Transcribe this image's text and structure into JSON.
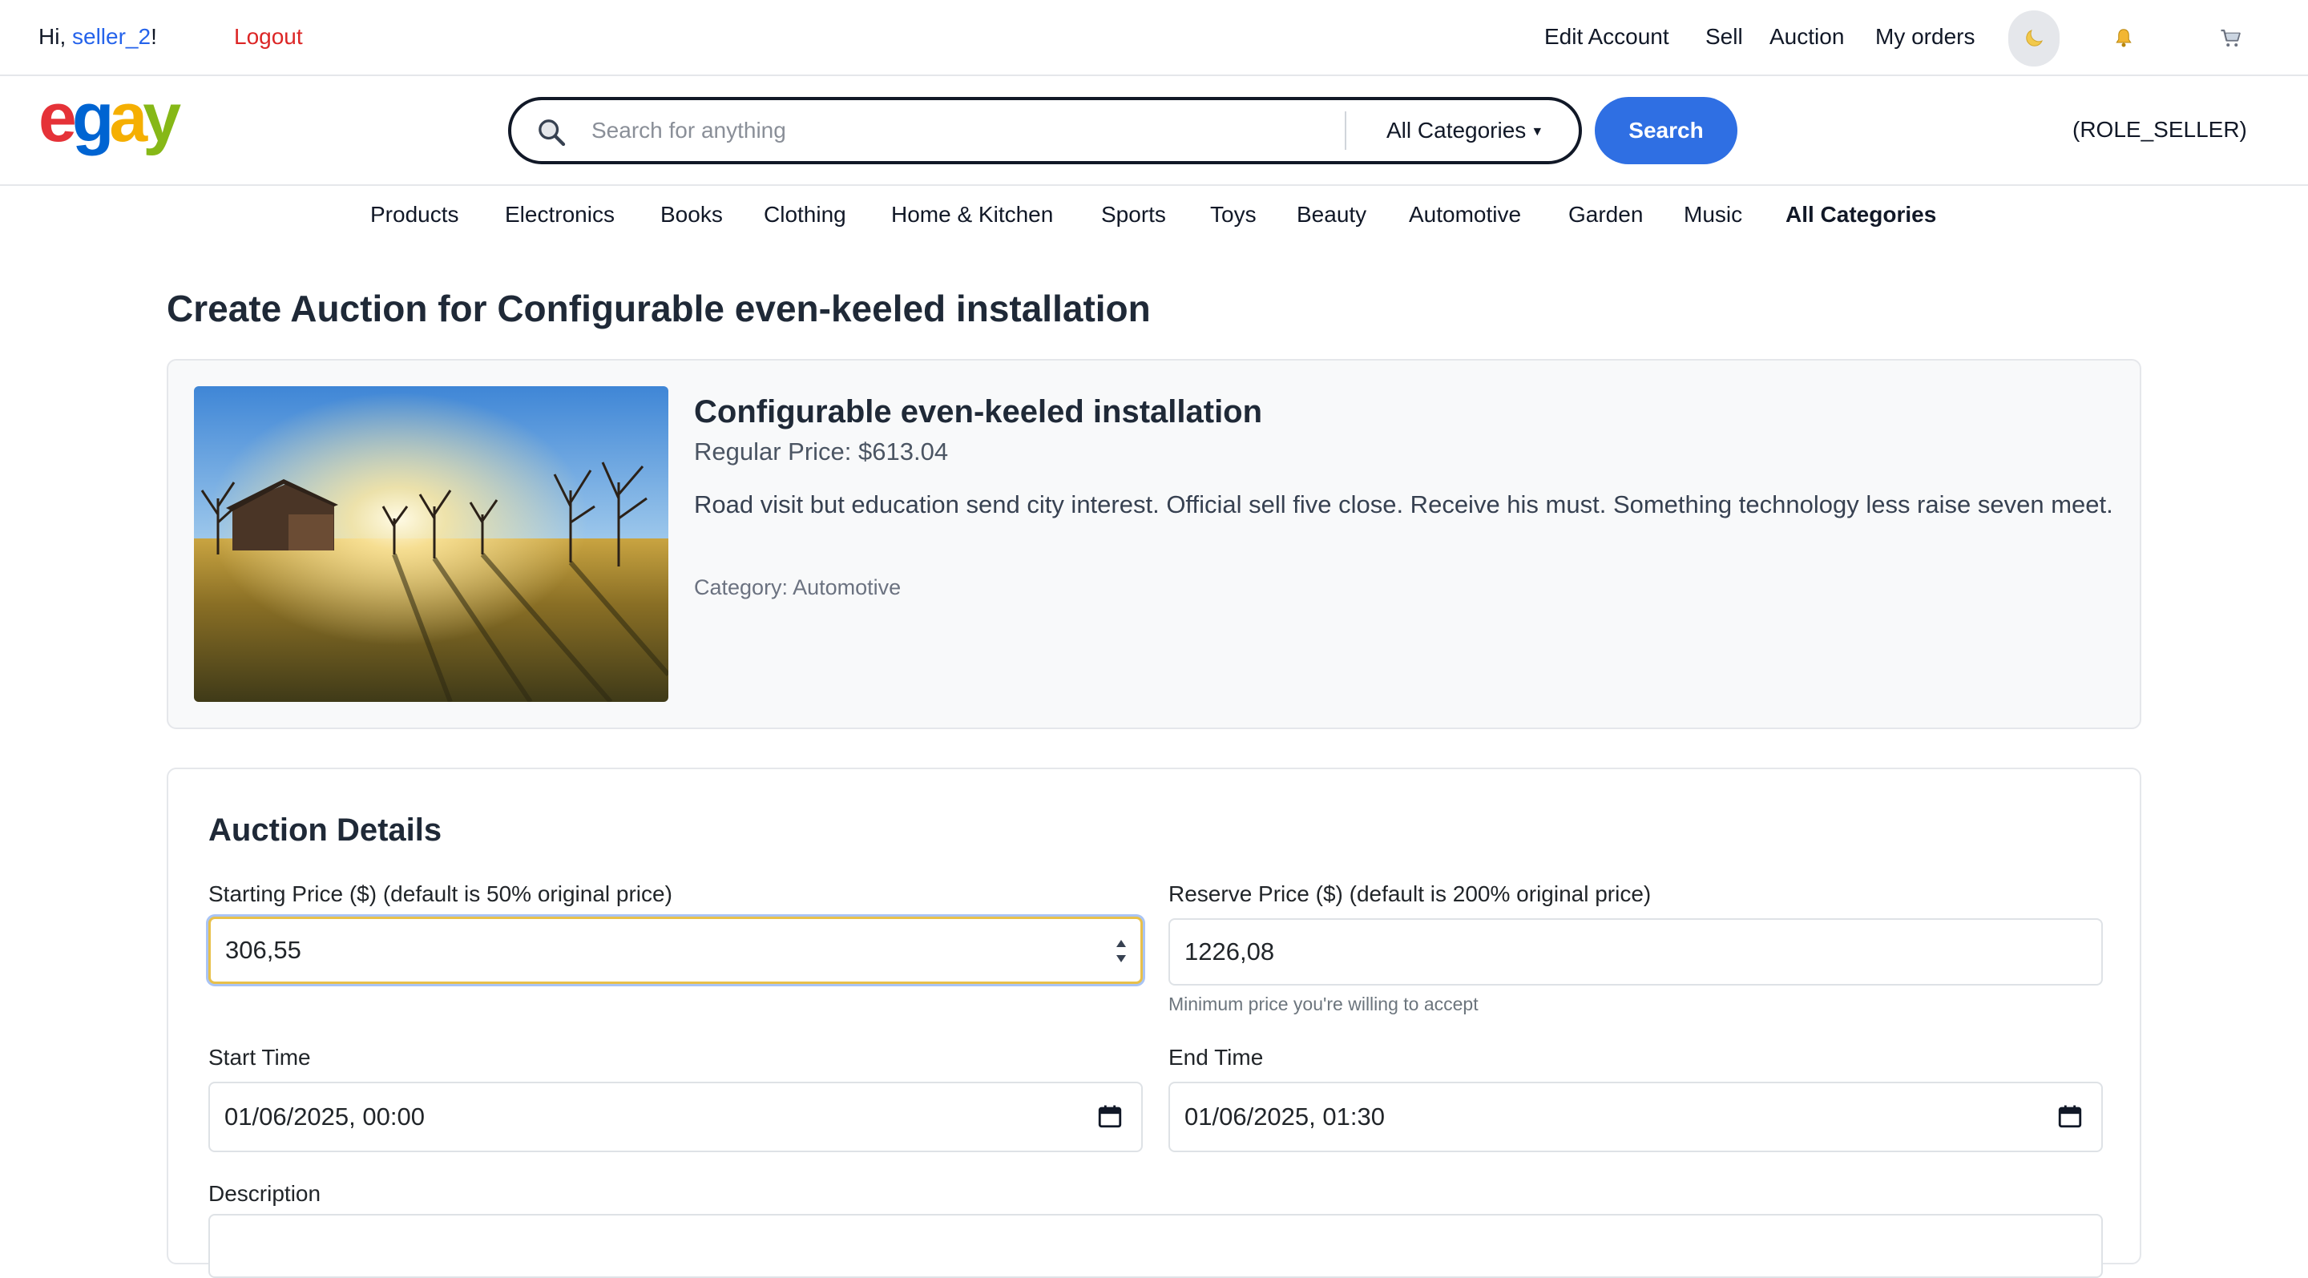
{
  "topbar": {
    "greeting_prefix": "Hi, ",
    "username": "seller_2",
    "greeting_suffix": "!",
    "logout": "Logout",
    "links": [
      "Edit Account",
      "Sell",
      "Auction",
      "My orders"
    ],
    "theme_icon": "moon-icon",
    "bell_icon": "bell-icon",
    "cart_icon": "cart-icon"
  },
  "header": {
    "logo_letters": [
      "e",
      "g",
      "a",
      "y"
    ],
    "logo_colors": [
      "#e53238",
      "#0064d2",
      "#f5af02",
      "#86b817"
    ],
    "search_placeholder": "Search for anything",
    "search_value": "",
    "category_selected": "All Categories",
    "search_button": "Search",
    "role": "(ROLE_SELLER)"
  },
  "catnav": [
    "Products",
    "Electronics",
    "Books",
    "Clothing",
    "Home & Kitchen",
    "Sports",
    "Toys",
    "Beauty",
    "Automotive",
    "Garden",
    "Music",
    "All Categories"
  ],
  "page": {
    "title": "Create Auction for Configurable even-keeled installation"
  },
  "product": {
    "name": "Configurable even-keeled installation",
    "price": "Regular Price: $613.04",
    "description": "Road visit but education send city interest. Official sell five close. Receive his must. Something technology less raise seven meet.",
    "category": "Category: Automotive"
  },
  "auction": {
    "title": "Auction Details",
    "starting_price_label": "Starting Price ($) (default is 50% original price)",
    "starting_price_value": "306,55",
    "reserve_price_label": "Reserve Price ($) (default is 200% original price)",
    "reserve_price_value": "1226,08",
    "reserve_hint": "Minimum price you're willing to accept",
    "start_time_label": "Start Time",
    "start_time_value": "01/06/2025, 00:00",
    "end_time_label": "End Time",
    "end_time_value": "01/06/2025, 01:30",
    "description_label": "Description"
  },
  "colors": {
    "accent": "#2f6fe3",
    "logout": "#dc2626",
    "username": "#2563eb"
  }
}
